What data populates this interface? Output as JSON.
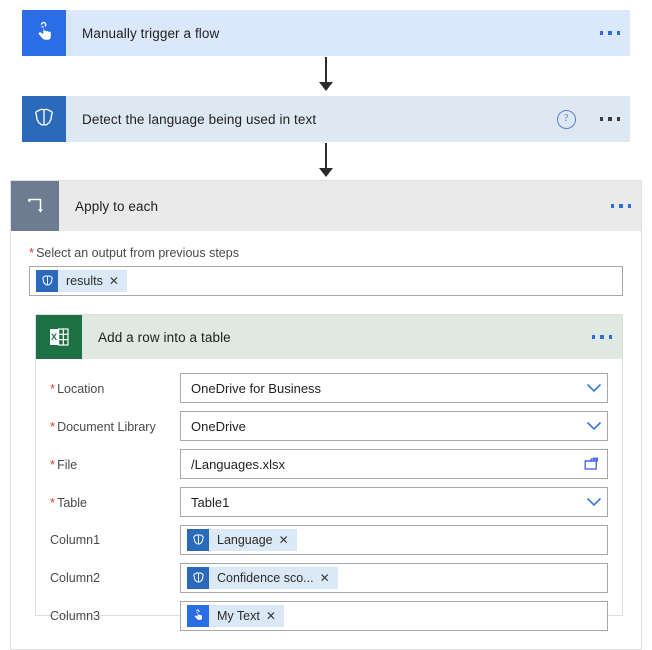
{
  "flow": {
    "trigger": {
      "title": "Manually trigger a flow",
      "icon": "hand-touch-icon",
      "bg_color": "#dbe8fb",
      "icon_bg": "#2b6de4",
      "menu": "..."
    },
    "detect": {
      "title": "Detect the language being used in text",
      "icon": "text-analytics-brain-icon",
      "bg_color": "#dee8f3",
      "icon_bg": "#2b6aba",
      "help": "?",
      "menu": "..."
    },
    "apply_to_each": {
      "title": "Apply to each",
      "icon": "loop-icon",
      "header_bg": "#eaeaea",
      "icon_bg": "#6e7c91",
      "menu": "...",
      "output_field": {
        "required": "*",
        "label": "Select an output from previous steps",
        "token": {
          "text": "results",
          "icon": "text-analytics-brain-icon",
          "remove": "✕"
        }
      }
    },
    "excel_action": {
      "title": "Add a row into a table",
      "icon": "excel-icon",
      "header_bg": "#dfe9e1",
      "icon_bg": "#1d7044",
      "menu": "...",
      "fields": [
        {
          "required": "*",
          "label": "Location",
          "value": "OneDrive for Business",
          "control": "dropdown"
        },
        {
          "required": "*",
          "label": "Document Library",
          "value": "OneDrive",
          "control": "dropdown"
        },
        {
          "required": "*",
          "label": "File",
          "value": "/Languages.xlsx",
          "control": "filepicker"
        },
        {
          "required": "*",
          "label": "Table",
          "value": "Table1",
          "control": "dropdown"
        }
      ],
      "columns": [
        {
          "label": "Column1",
          "token": {
            "text": "Language",
            "icon": "text-analytics-brain-icon",
            "remove": "✕"
          }
        },
        {
          "label": "Column2",
          "token": {
            "text": "Confidence sco...",
            "icon": "text-analytics-brain-icon",
            "remove": "✕"
          }
        },
        {
          "label": "Column3",
          "token": {
            "text": "My Text",
            "icon": "hand-touch-icon",
            "remove": "✕"
          }
        }
      ]
    }
  },
  "colors": {
    "accent_blue": "#2b6de4",
    "required_red": "#d23f31",
    "excel_green": "#1d7044",
    "loop_gray": "#6e7c91"
  }
}
